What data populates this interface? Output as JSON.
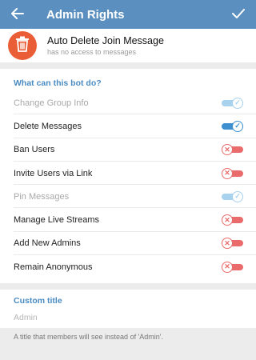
{
  "appbar": {
    "title": "Admin Rights",
    "back_icon": "arrow-left-icon",
    "confirm_icon": "check-icon",
    "color": "#5a8fbf"
  },
  "bot": {
    "name": "Auto Delete Join Message",
    "status": "has no access to messages",
    "avatar_icon": "trash-can-icon",
    "avatar_color": "#ea5e37"
  },
  "permissions": {
    "heading": "What can this bot do?",
    "items": [
      {
        "label": "Change Group Info",
        "enabled": true,
        "disabled": true
      },
      {
        "label": "Delete Messages",
        "enabled": true,
        "disabled": false
      },
      {
        "label": "Ban Users",
        "enabled": false,
        "disabled": false
      },
      {
        "label": "Invite Users via Link",
        "enabled": false,
        "disabled": false
      },
      {
        "label": "Pin Messages",
        "enabled": true,
        "disabled": true
      },
      {
        "label": "Manage Live Streams",
        "enabled": false,
        "disabled": false
      },
      {
        "label": "Add New Admins",
        "enabled": false,
        "disabled": false
      },
      {
        "label": "Remain Anonymous",
        "enabled": false,
        "disabled": false
      }
    ]
  },
  "custom_title": {
    "heading": "Custom title",
    "placeholder": "Admin",
    "hint": "A title that members will see instead of 'Admin'."
  },
  "colors": {
    "accent": "#4a8bc2",
    "toggle_on": "#3e8fcf",
    "toggle_on_disabled": "#a9d2ee",
    "toggle_off": "#ea6b6b"
  }
}
